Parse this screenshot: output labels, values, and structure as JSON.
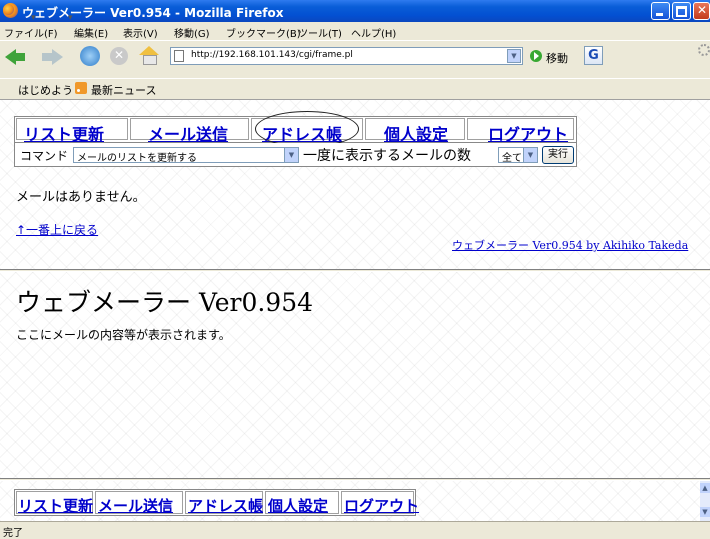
{
  "window": {
    "title": "ウェブメーラー Ver0.954 - Mozilla Firefox"
  },
  "menu": {
    "items": [
      "ファイル(F)",
      "編集(E)",
      "表示(V)",
      "移動(G)",
      "ブックマーク(B)",
      "ツール(T)",
      "ヘルプ(H)"
    ]
  },
  "toolbar": {
    "url": "http://192.168.101.143/cgi/frame.pl",
    "go_label": "移動",
    "google_glyph": "G"
  },
  "bookmarks": {
    "items": [
      "はじめよう",
      "最新ニュース"
    ]
  },
  "topframe": {
    "nav": [
      "リスト更新",
      "メール送信",
      "アドレス帳",
      "個人設定",
      "ログアウト"
    ],
    "command_label": "コマンド",
    "command_value": "メールのリストを更新する",
    "count_label": "一度に表示するメールの数",
    "count_value": "全て",
    "execute_label": "実行",
    "message": "メールはありません。",
    "back_to_top": "↑一番上に戻る",
    "credit": "ウェブメーラー Ver0.954 by Akihiko Takeda"
  },
  "mainframe": {
    "title": "ウェブメーラー Ver0.954",
    "text": "ここにメールの内容等が表示されます。"
  },
  "bottomframe": {
    "nav": [
      "リスト更新",
      "メール送信",
      "アドレス帳",
      "個人設定",
      "ログアウト"
    ]
  },
  "status": {
    "text": "完了"
  },
  "colors": {
    "link": "#0000CC",
    "titlebar": "#0A5ED8"
  }
}
